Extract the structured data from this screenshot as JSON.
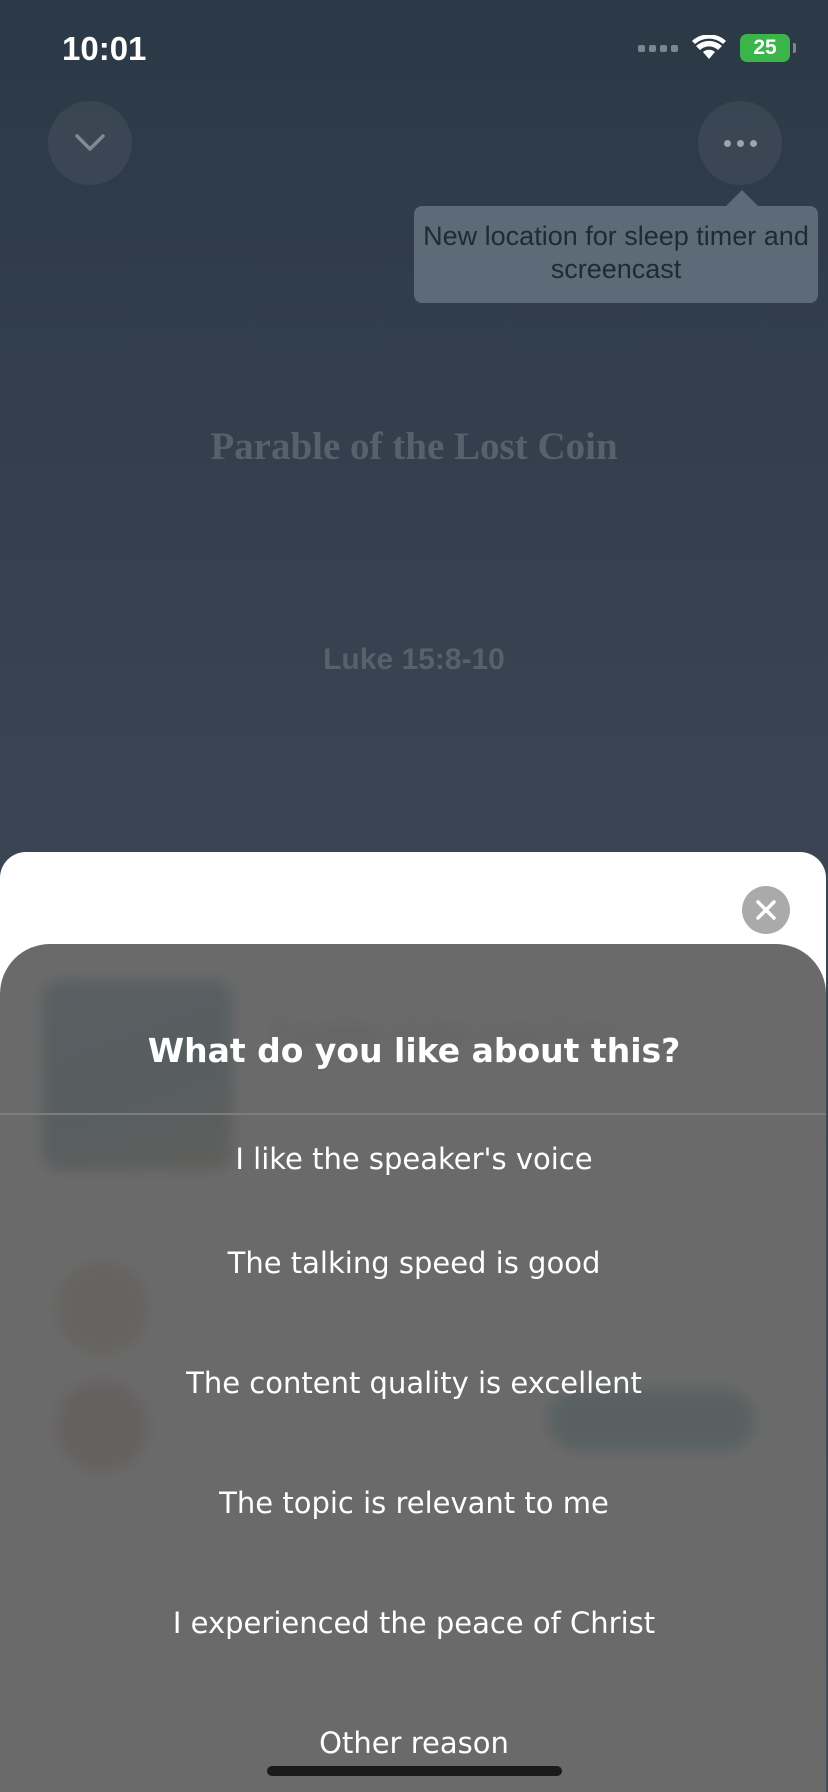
{
  "status_bar": {
    "time": "10:01",
    "battery": "25"
  },
  "tooltip": {
    "text": "New location for sleep timer and screencast"
  },
  "player": {
    "title": "Parable of the Lost Coin",
    "reference": "Luke 15:8-10"
  },
  "feedback": {
    "title": "What do you like about this?",
    "options": [
      "I like the speaker's voice",
      "The talking speed is good",
      "The content quality is excellent",
      "The topic is relevant to me",
      "I experienced the peace of Christ",
      "Other reason"
    ]
  },
  "colors": {
    "panel": "#5f5f5f",
    "accent": "#0e7a78",
    "battery": "#3bb54a"
  },
  "icons": [
    "chevron-down-icon",
    "more-icon",
    "close-icon",
    "wifi-icon",
    "signal-icon"
  ]
}
